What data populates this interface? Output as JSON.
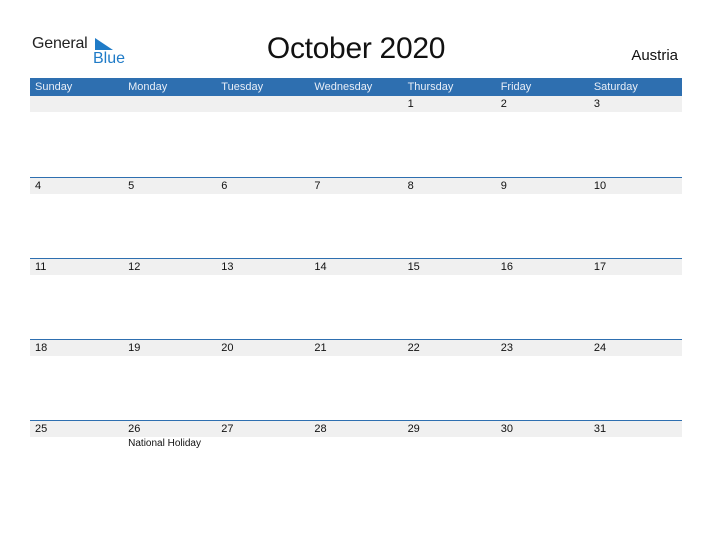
{
  "logo": {
    "word1": "General",
    "word2": "Blue",
    "accent": "#1f7bc7"
  },
  "title": "October 2020",
  "country": "Austria",
  "colors": {
    "header_bg": "#2e6fb0",
    "band_bg": "#f0f0f0"
  },
  "weekdays": [
    "Sunday",
    "Monday",
    "Tuesday",
    "Wednesday",
    "Thursday",
    "Friday",
    "Saturday"
  ],
  "weeks": [
    {
      "days": [
        {
          "d": ""
        },
        {
          "d": ""
        },
        {
          "d": ""
        },
        {
          "d": ""
        },
        {
          "d": "1"
        },
        {
          "d": "2"
        },
        {
          "d": "3"
        }
      ]
    },
    {
      "days": [
        {
          "d": "4"
        },
        {
          "d": "5"
        },
        {
          "d": "6"
        },
        {
          "d": "7"
        },
        {
          "d": "8"
        },
        {
          "d": "9"
        },
        {
          "d": "10"
        }
      ]
    },
    {
      "days": [
        {
          "d": "11"
        },
        {
          "d": "12"
        },
        {
          "d": "13"
        },
        {
          "d": "14"
        },
        {
          "d": "15"
        },
        {
          "d": "16"
        },
        {
          "d": "17"
        }
      ]
    },
    {
      "days": [
        {
          "d": "18"
        },
        {
          "d": "19"
        },
        {
          "d": "20"
        },
        {
          "d": "21"
        },
        {
          "d": "22"
        },
        {
          "d": "23"
        },
        {
          "d": "24"
        }
      ]
    },
    {
      "days": [
        {
          "d": "25"
        },
        {
          "d": "26",
          "event": "National Holiday"
        },
        {
          "d": "27"
        },
        {
          "d": "28"
        },
        {
          "d": "29"
        },
        {
          "d": "30"
        },
        {
          "d": "31"
        }
      ]
    }
  ]
}
